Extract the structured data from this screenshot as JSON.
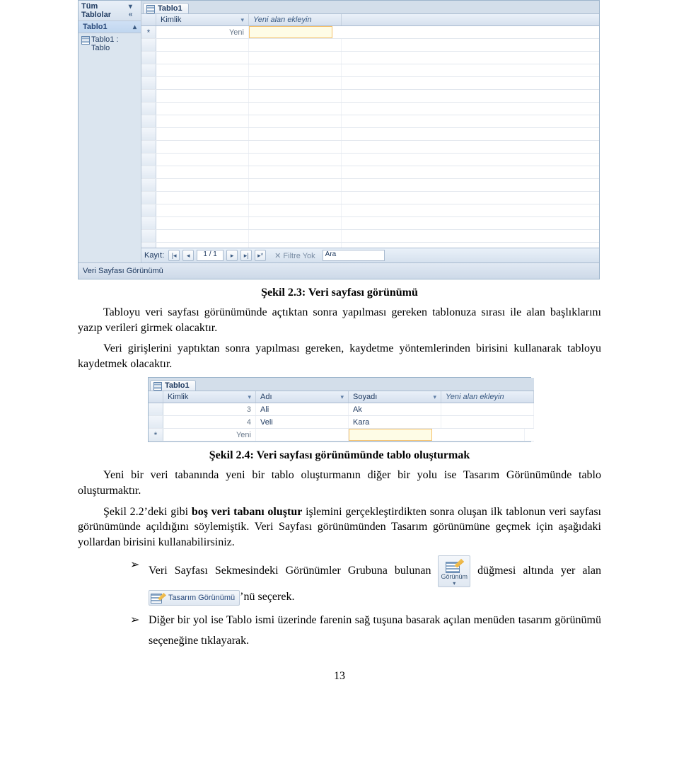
{
  "shot1": {
    "sidebar_head": "Tüm Tablolar",
    "sidebar_group": "Tablo1",
    "sidebar_item": "Tablo1 : Tablo",
    "tab": "Tablo1",
    "col_kimlik": "Kimlik",
    "col_yeni": "Yeni alan ekleyin",
    "row_new_kimlik": "Yeni",
    "nav_label": "Kayıt:",
    "nav_pos": "1 / 1",
    "filter": "Filtre Yok",
    "search": "Ara",
    "status": "Veri Sayfası Görünümü"
  },
  "caption1": "Şekil 2.3: Veri sayfası görünümü",
  "para1": "Tabloyu veri sayfası görünümünde açtıktan sonra yapılması gereken tablonuza sırası ile alan başlıklarını yazıp verileri girmek olacaktır.",
  "para2": "Veri girişlerini yaptıktan sonra yapılması gereken, kaydetme yöntemlerinden birisini kullanarak tabloyu kaydetmek olacaktır.",
  "shot2": {
    "tab": "Tablo1",
    "col_kimlik": "Kimlik",
    "col_adi": "Adı",
    "col_soyadi": "Soyadı",
    "col_yeni": "Yeni alan ekleyin",
    "rows": [
      {
        "id": "3",
        "adi": "Ali",
        "soyadi": "Ak"
      },
      {
        "id": "4",
        "adi": "Veli",
        "soyadi": "Kara"
      }
    ],
    "row_new": "Yeni"
  },
  "caption2": "Şekil 2.4: Veri sayfası görünümünde tablo oluşturmak",
  "para3": "Yeni bir veri tabanında yeni bir tablo oluşturmanın diğer bir yolu ise Tasarım Görünümünde tablo oluşturmaktır.",
  "para4_a": "Şekil 2.2’deki gibi ",
  "para4_b": "boş veri tabanı oluştur",
  "para4_c": " işlemini gerçekleştirdikten sonra oluşan ilk tablonun veri sayfası görünümünde açıldığını söylemiştik. Veri Sayfası görünümünden Tasarım görünümüne geçmek için aşağıdaki yollardan birisini kullanabilirsiniz.",
  "bullet1_a": "Veri Sayfası Sekmesindeki Görünümler Grubuna bulunan ",
  "bullet1_b": " düğmesi altında yer alan ",
  "bullet1_c": "’nü seçerek.",
  "bullet2": "Diğer bir yol ise Tablo ismi üzerinde farenin sağ tuşuna basarak açılan menüden tasarım görünümü seçeneğine tıklayarak.",
  "btn_gorunum_label": "Görünüm",
  "btn_tasarim_label": "Tasarım Görünümü",
  "pagenum": "13"
}
